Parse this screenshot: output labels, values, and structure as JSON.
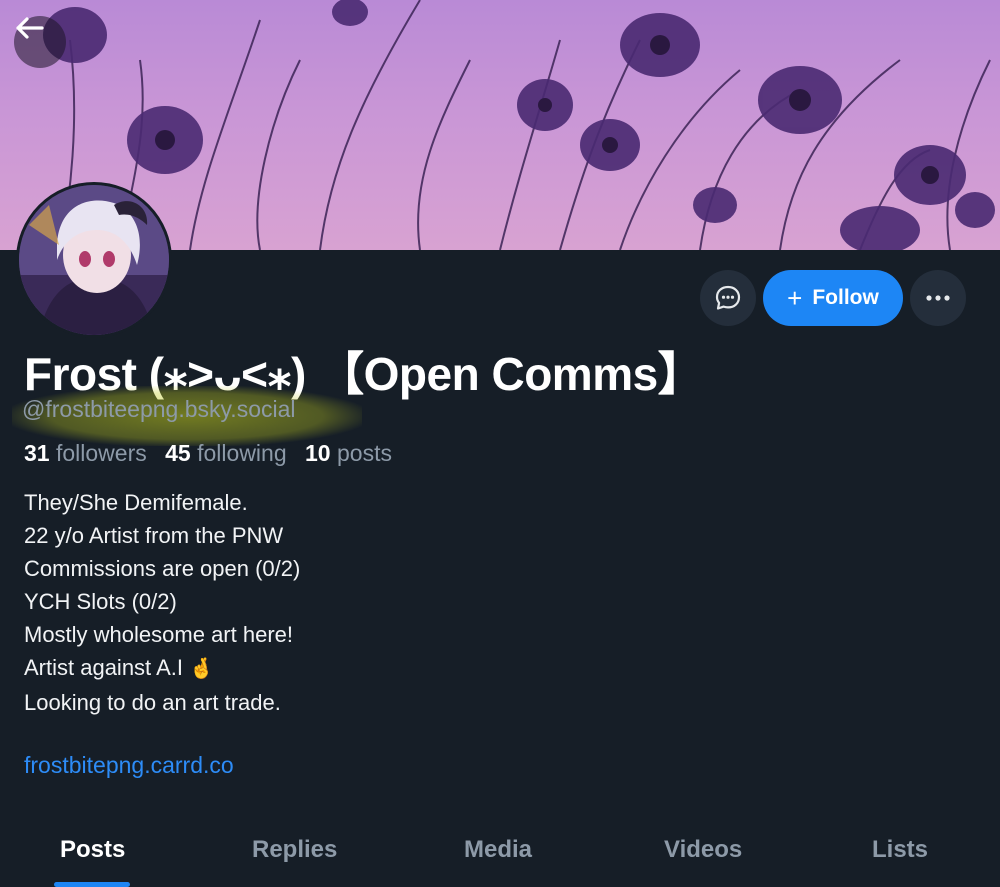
{
  "header": {
    "back_label": "Back"
  },
  "profile": {
    "display_name": "Frost (⁎˃ᴗ˂⁎) 【Open Comms】",
    "handle": "@frostbiteepng.bsky.social",
    "stats": {
      "followers_count": "31",
      "followers_label": "followers",
      "following_count": "45",
      "following_label": "following",
      "posts_count": "10",
      "posts_label": "posts"
    },
    "bio_lines": [
      "They/She Demifemale.",
      "22 y/o Artist from the PNW",
      "Commissions are open (0/2)",
      "YCH Slots (0/2)",
      "Mostly wholesome art here!",
      "Artist against A.I",
      "Looking to do an art trade."
    ],
    "bio_emoji": "🤞",
    "link": "frostbitepng.carrd.co"
  },
  "actions": {
    "follow_label": "Follow",
    "follow_icon": "plus-icon",
    "message_icon": "chat-bubble-icon",
    "more_icon": "ellipsis-icon"
  },
  "tabs": [
    {
      "label": "Posts",
      "active": true
    },
    {
      "label": "Replies",
      "active": false
    },
    {
      "label": "Media",
      "active": false
    },
    {
      "label": "Videos",
      "active": false
    },
    {
      "label": "Lists",
      "active": false
    }
  ],
  "colors": {
    "background": "#161e27",
    "accent": "#1d86f5",
    "muted_text": "#8d9aa8",
    "link": "#2d8cf7",
    "highlight": "#bec81e"
  }
}
